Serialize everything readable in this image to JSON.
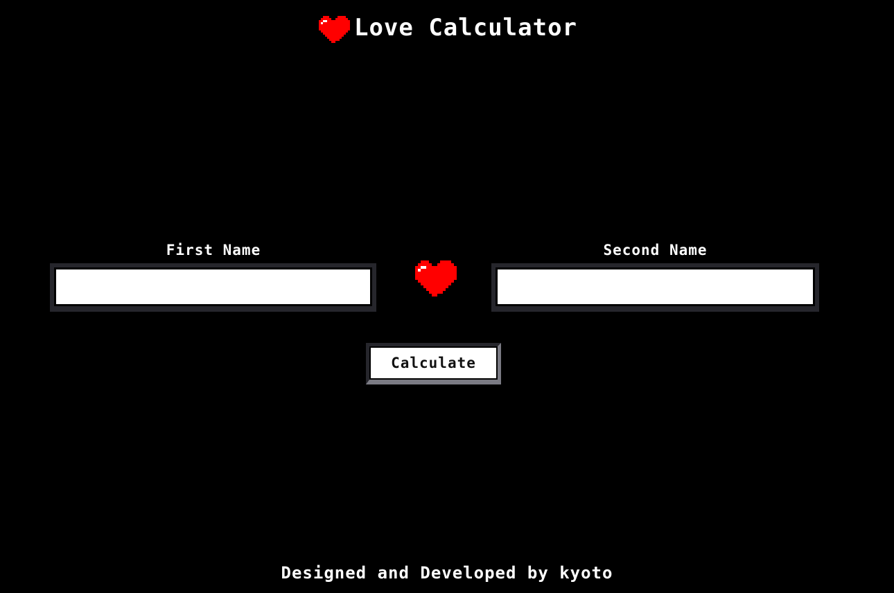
{
  "header": {
    "title": "Love Calculator",
    "icon": "heart-icon"
  },
  "form": {
    "first_label": "First Name",
    "first_value": "",
    "second_label": "Second Name",
    "second_value": "",
    "center_icon": "heart-icon",
    "button_label": "Calculate"
  },
  "footer": {
    "credit": "Designed and Developed by kyoto"
  },
  "colors": {
    "background": "#000000",
    "text": "#ffffff",
    "heart": "#ff0000",
    "heart_highlight": "#ffffff",
    "field_border": "#26262c"
  }
}
